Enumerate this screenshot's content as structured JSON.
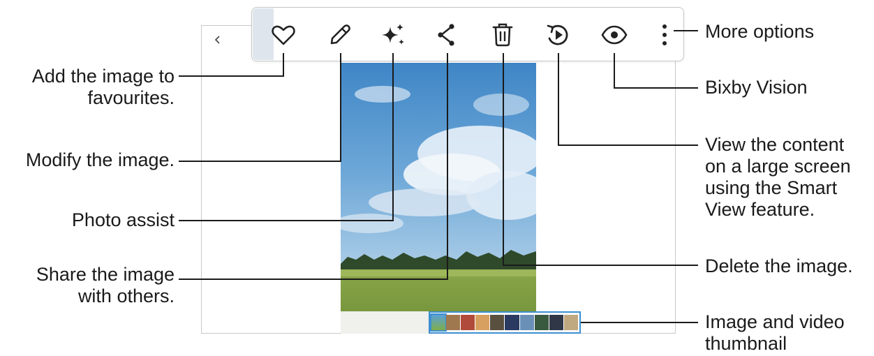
{
  "toolbar": {
    "buttons": [
      {
        "icon": "heart-icon",
        "name": "favourite-button"
      },
      {
        "icon": "pencil-icon",
        "name": "edit-button"
      },
      {
        "icon": "sparkle-icon",
        "name": "photo-assist-button"
      },
      {
        "icon": "share-icon",
        "name": "share-button"
      },
      {
        "icon": "trash-icon",
        "name": "delete-button"
      },
      {
        "icon": "smart-view-icon",
        "name": "smart-view-button"
      },
      {
        "icon": "eye-icon",
        "name": "bixby-vision-button"
      },
      {
        "icon": "more-vertical-icon",
        "name": "more-options-button"
      }
    ]
  },
  "callouts": {
    "favourites": {
      "line1": "Add the image to",
      "line2": "favourites."
    },
    "modify": "Modify the image.",
    "photo_assist": "Photo assist",
    "share": {
      "line1": "Share the image",
      "line2": "with others."
    },
    "more_options": "More options",
    "bixby_vision": "Bixby Vision",
    "smart_view": {
      "line1": "View the content",
      "line2": "on a large screen",
      "line3": "using the Smart",
      "line4": "View feature."
    },
    "delete": "Delete the image.",
    "thumbnail": {
      "line1": "Image and video",
      "line2": "thumbnail"
    }
  },
  "colors": {
    "accent": "#3d8fd0",
    "line": "#1a1a1a",
    "toolbar_highlight": "#dfe5ec"
  },
  "icons": {
    "back": "chevron-left-icon"
  }
}
